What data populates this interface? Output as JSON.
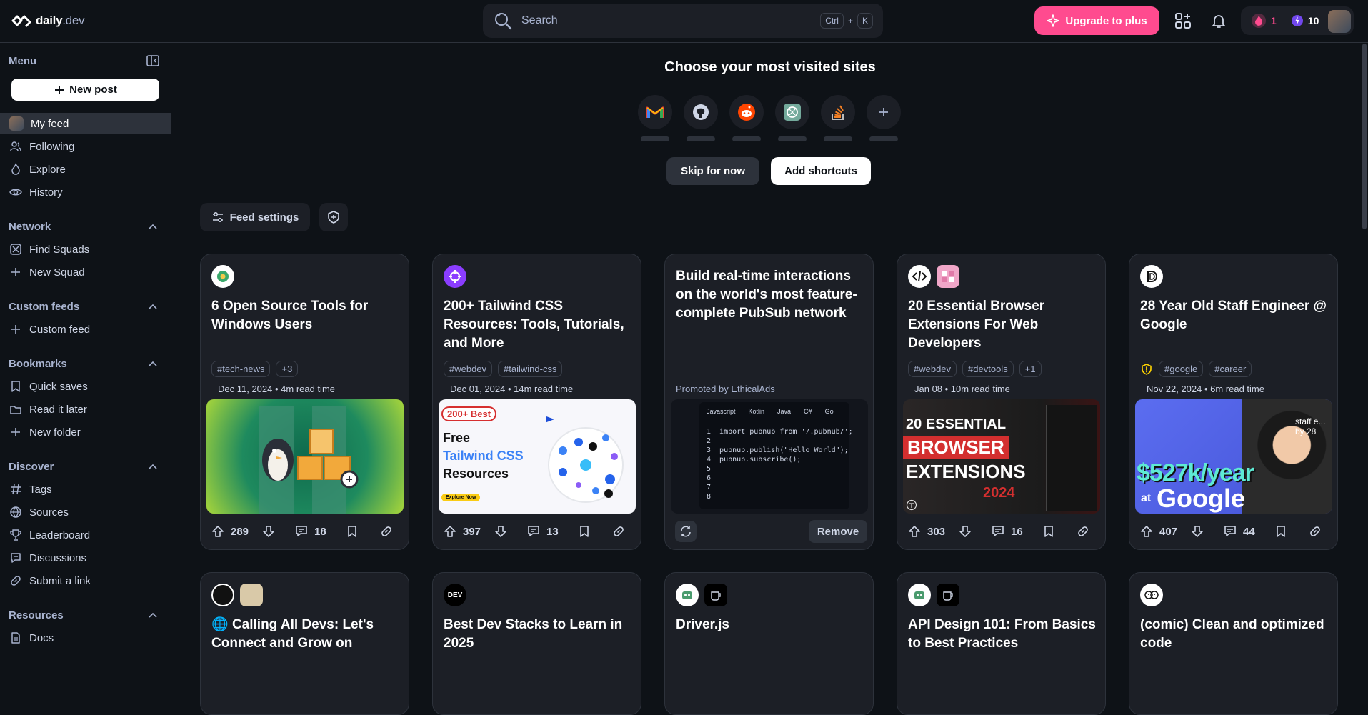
{
  "header": {
    "logo_daily": "daily",
    "logo_dev": ".dev",
    "search_placeholder": "Search",
    "kbd_ctrl": "Ctrl",
    "kbd_plus": "+",
    "kbd_k": "K",
    "upgrade_label": "Upgrade to plus",
    "streak_count": "1",
    "reputation": "10"
  },
  "sidebar": {
    "menu_title": "Menu",
    "new_post": "New post",
    "menu_items": [
      "My feed",
      "Following",
      "Explore",
      "History"
    ],
    "network_title": "Network",
    "network_items": [
      "Find Squads",
      "New Squad"
    ],
    "custom_title": "Custom feeds",
    "custom_items": [
      "Custom feed"
    ],
    "bookmarks_title": "Bookmarks",
    "bookmark_items": [
      "Quick saves",
      "Read it later",
      "New folder"
    ],
    "discover_title": "Discover",
    "discover_items": [
      "Tags",
      "Sources",
      "Leaderboard",
      "Discussions",
      "Submit a link"
    ],
    "resources_title": "Resources",
    "resource_items": [
      "Docs"
    ]
  },
  "shortcuts": {
    "title": "Choose your most visited sites",
    "sites": [
      "gmail-icon",
      "github-icon",
      "reddit-icon",
      "chatgpt-icon",
      "stackoverflow-icon",
      "add-icon"
    ],
    "skip": "Skip for now",
    "add": "Add shortcuts"
  },
  "feed": {
    "settings_label": "Feed settings",
    "cards": [
      {
        "title": "6 Open Source Tools for Windows Users",
        "tags": [
          "#tech-news",
          "+3"
        ],
        "meta": "Dec 11, 2024 • 4m read time",
        "upvotes": "289",
        "comments": "18"
      },
      {
        "title": "200+ Tailwind CSS Resources: Tools, Tutorials, and More",
        "tags": [
          "#webdev",
          "#tailwind-css"
        ],
        "meta": "Dec 01, 2024 • 14m read time",
        "upvotes": "397",
        "comments": "13",
        "thumb_badge": "200+ Best",
        "thumb_l1": "Free",
        "thumb_l2": "Tailwind CSS",
        "thumb_l3": "Resources",
        "thumb_btn": "Explore Now"
      },
      {
        "title": "Build real-time interactions on the world's most feature-complete PubSub network",
        "promoted": "Promoted by EthicalAds",
        "remove": "Remove",
        "code_tabs": [
          "Javascript",
          "Kotlin",
          "Java",
          "C#",
          "Go"
        ],
        "code_lines": [
          "1  import pubnub from '/.pubnub/';",
          "2",
          "3  pubnub.publish(\"Hello World\");",
          "4  pubnub.subscribe();",
          "5",
          "6",
          "7",
          "8"
        ]
      },
      {
        "title": "20 Essential Browser Extensions For Web Developers",
        "tags": [
          "#webdev",
          "#devtools",
          "+1"
        ],
        "meta": "Jan 08 • 10m read time",
        "upvotes": "303",
        "comments": "16",
        "thumb_l1": "20 ESSENTIAL",
        "thumb_l2": "BROWSER",
        "thumb_l3": "EXTENSIONS",
        "thumb_l4": "2024"
      },
      {
        "title": "28 Year Old Staff Engineer @ Google",
        "tags": [
          "#google",
          "#career"
        ],
        "meta": "Nov 22, 2024 • 6m read time",
        "upvotes": "407",
        "comments": "44",
        "thumb_l1": "$527k/year",
        "thumb_l2": "at",
        "thumb_l3": "Google",
        "thumb_corner": "staff e... by 28"
      }
    ],
    "row2": [
      {
        "title": "Calling All Devs: Let's Connect and Grow on"
      },
      {
        "title": "Best Dev Stacks to Learn in 2025",
        "src": "DEV"
      },
      {
        "title": "Driver.js"
      },
      {
        "title": "API Design 101: From Basics to Best Practices"
      },
      {
        "title": "(comic) Clean and optimized code"
      }
    ]
  }
}
